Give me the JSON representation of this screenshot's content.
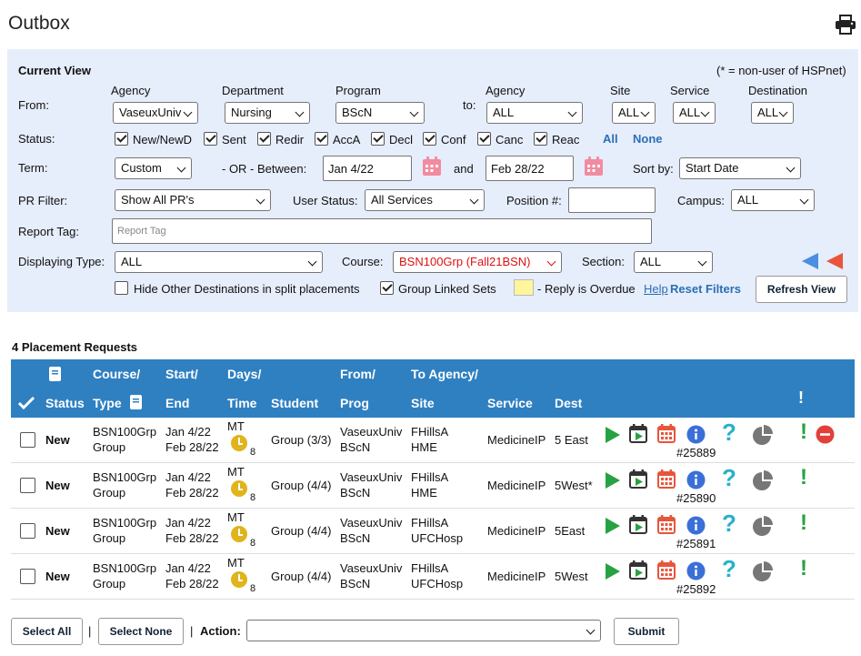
{
  "page": {
    "title": "Outbox"
  },
  "filters": {
    "heading": "Current View",
    "note": "(* = non-user of HSPnet)",
    "from_label": "From:",
    "to_label": "to:",
    "agency_hdr": "Agency",
    "department_hdr": "Department",
    "program_hdr": "Program",
    "agency2_hdr": "Agency",
    "site_hdr": "Site",
    "service_hdr": "Service",
    "destination_hdr": "Destination",
    "agency_value": "VaseuxUniv",
    "department_value": "Nursing",
    "program_value": "BScN",
    "to_agency_value": "ALL",
    "site_value": "ALL",
    "service_value": "ALL",
    "destination_value": "ALL",
    "status_label": "Status:",
    "statuses": [
      {
        "label": "New/NewD",
        "checked": true
      },
      {
        "label": "Sent",
        "checked": true
      },
      {
        "label": "Redir",
        "checked": true
      },
      {
        "label": "AccA",
        "checked": true
      },
      {
        "label": "Decl",
        "checked": true
      },
      {
        "label": "Conf",
        "checked": true
      },
      {
        "label": "Canc",
        "checked": true
      },
      {
        "label": "Reac",
        "checked": true
      }
    ],
    "all_link": "All",
    "none_link": "None",
    "term_label": "Term:",
    "term_value": "Custom",
    "or_between": "- OR -  Between:",
    "start_date": "Jan 4/22",
    "and_label": "and",
    "end_date": "Feb 28/22",
    "sortby_label": "Sort by:",
    "sortby_value": "Start Date",
    "pr_filter_label": "PR Filter:",
    "pr_filter_value": "Show All PR's",
    "user_status_label": "User Status:",
    "user_status_value": "All Services",
    "position_label": "Position #:",
    "position_value": "",
    "campus_label": "Campus:",
    "campus_value": "ALL",
    "report_tag_label": "Report Tag:",
    "report_tag_placeholder": "Report Tag",
    "displaying_type_label": "Displaying Type:",
    "displaying_type_value": "ALL",
    "course_label": "Course:",
    "course_value": "BSN100Grp (Fall21BSN)",
    "section_label": "Section:",
    "section_value": "ALL",
    "hide_other_label": "Hide Other Destinations in split placements",
    "group_linked_label": "Group Linked Sets",
    "overdue_label": "- Reply is Overdue",
    "help_link": "Help",
    "reset_link": "Reset Filters",
    "refresh_button": "Refresh View",
    "colors": {
      "panel_bg": "#e6edfb",
      "overdue_swatch": "#fff59d",
      "arrow_blue": "#4a8fe0",
      "arrow_red": "#e8553b"
    }
  },
  "results": {
    "count_label": "4 Placement Requests",
    "headers": {
      "status": "Status",
      "course_top": "Course/",
      "course_bottom": "Type",
      "start_top": "Start/",
      "start_bottom": "End",
      "days_top": "Days/",
      "days_bottom": "Time",
      "student": "Student",
      "from_top": "From/",
      "from_bottom": "Prog",
      "to_top": "To Agency/",
      "to_bottom": "Site",
      "service": "Service",
      "dest": "Dest",
      "alert": "!"
    },
    "rows": [
      {
        "status": "New",
        "course": "BSN100Grp",
        "type": "Group",
        "start": "Jan 4/22",
        "end": "Feb 28/22",
        "days": "MT",
        "hours": "8",
        "student": "Group (3/3)",
        "from": "VaseuxUniv",
        "prog": "BScN",
        "to_agency": "FHillsA",
        "site": "HME",
        "service": "MedicineIP",
        "dest": "5 East",
        "req": "#25889",
        "has_delete": true
      },
      {
        "status": "New",
        "course": "BSN100Grp",
        "type": "Group",
        "start": "Jan 4/22",
        "end": "Feb 28/22",
        "days": "MT",
        "hours": "8",
        "student": "Group (4/4)",
        "from": "VaseuxUniv",
        "prog": "BScN",
        "to_agency": "FHillsA",
        "site": "HME",
        "service": "MedicineIP",
        "dest": "5West*",
        "req": "#25890",
        "has_delete": false
      },
      {
        "status": "New",
        "course": "BSN100Grp",
        "type": "Group",
        "start": "Jan 4/22",
        "end": "Feb 28/22",
        "days": "MT",
        "hours": "8",
        "student": "Group (4/4)",
        "from": "VaseuxUniv",
        "prog": "BScN",
        "to_agency": "FHillsA",
        "site": "UFCHosp",
        "service": "MedicineIP",
        "dest": "5East",
        "req": "#25891",
        "has_delete": false
      },
      {
        "status": "New",
        "course": "BSN100Grp",
        "type": "Group",
        "start": "Jan 4/22",
        "end": "Feb 28/22",
        "days": "MT",
        "hours": "8",
        "student": "Group (4/4)",
        "from": "VaseuxUniv",
        "prog": "BScN",
        "to_agency": "FHillsA",
        "site": "UFCHosp",
        "service": "MedicineIP",
        "dest": "5West",
        "req": "#25892",
        "has_delete": false
      }
    ],
    "colors": {
      "header_bg": "#2f80c1",
      "play": "#27a243",
      "calendar": "#e8553b",
      "info": "#3b6fd8",
      "help": "#27b1c9",
      "alert": "#27a243",
      "delete": "#e0413a"
    }
  },
  "footer": {
    "select_all": "Select All",
    "select_none": "Select None",
    "sep": "|",
    "action_label": "Action:",
    "action_value": "",
    "submit": "Submit"
  }
}
